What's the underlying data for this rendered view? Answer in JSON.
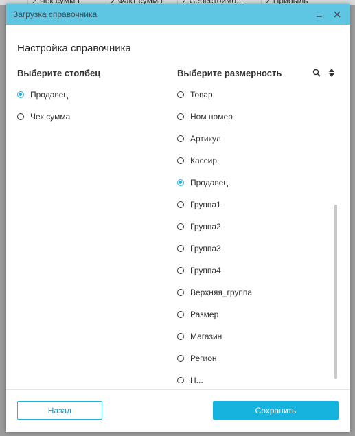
{
  "background": {
    "columns": [
      "Σ Чек сумма",
      "Σ Факт сумма",
      "Σ Себестоимо...",
      "Σ Прибыль"
    ]
  },
  "dialog": {
    "title": "Загрузка справочника",
    "heading": "Настройка справочника",
    "left_column": {
      "heading": "Выберите столбец",
      "options": [
        {
          "label": "Продавец",
          "checked": true
        },
        {
          "label": "Чек сумма",
          "checked": false
        }
      ]
    },
    "right_column": {
      "heading": "Выберите размерность",
      "options": [
        {
          "label": "Товар",
          "checked": false
        },
        {
          "label": "Ном номер",
          "checked": false
        },
        {
          "label": "Артикул",
          "checked": false
        },
        {
          "label": "Кассир",
          "checked": false
        },
        {
          "label": "Продавец",
          "checked": true
        },
        {
          "label": "Группа1",
          "checked": false
        },
        {
          "label": "Группа2",
          "checked": false
        },
        {
          "label": "Группа3",
          "checked": false
        },
        {
          "label": "Группа4",
          "checked": false
        },
        {
          "label": "Верхняя_группа",
          "checked": false
        },
        {
          "label": "Размер",
          "checked": false
        },
        {
          "label": "Магазин",
          "checked": false
        },
        {
          "label": "Регион",
          "checked": false
        },
        {
          "label": "Н...",
          "checked": false
        }
      ]
    },
    "buttons": {
      "back": "Назад",
      "save": "Сохранить"
    },
    "icons": {
      "minimize": "minimize-icon",
      "close": "close-icon",
      "search": "search-icon",
      "sort": "sort-icon"
    },
    "colors": {
      "titlebar": "#5ec6e3",
      "accent": "#16b3df"
    }
  }
}
